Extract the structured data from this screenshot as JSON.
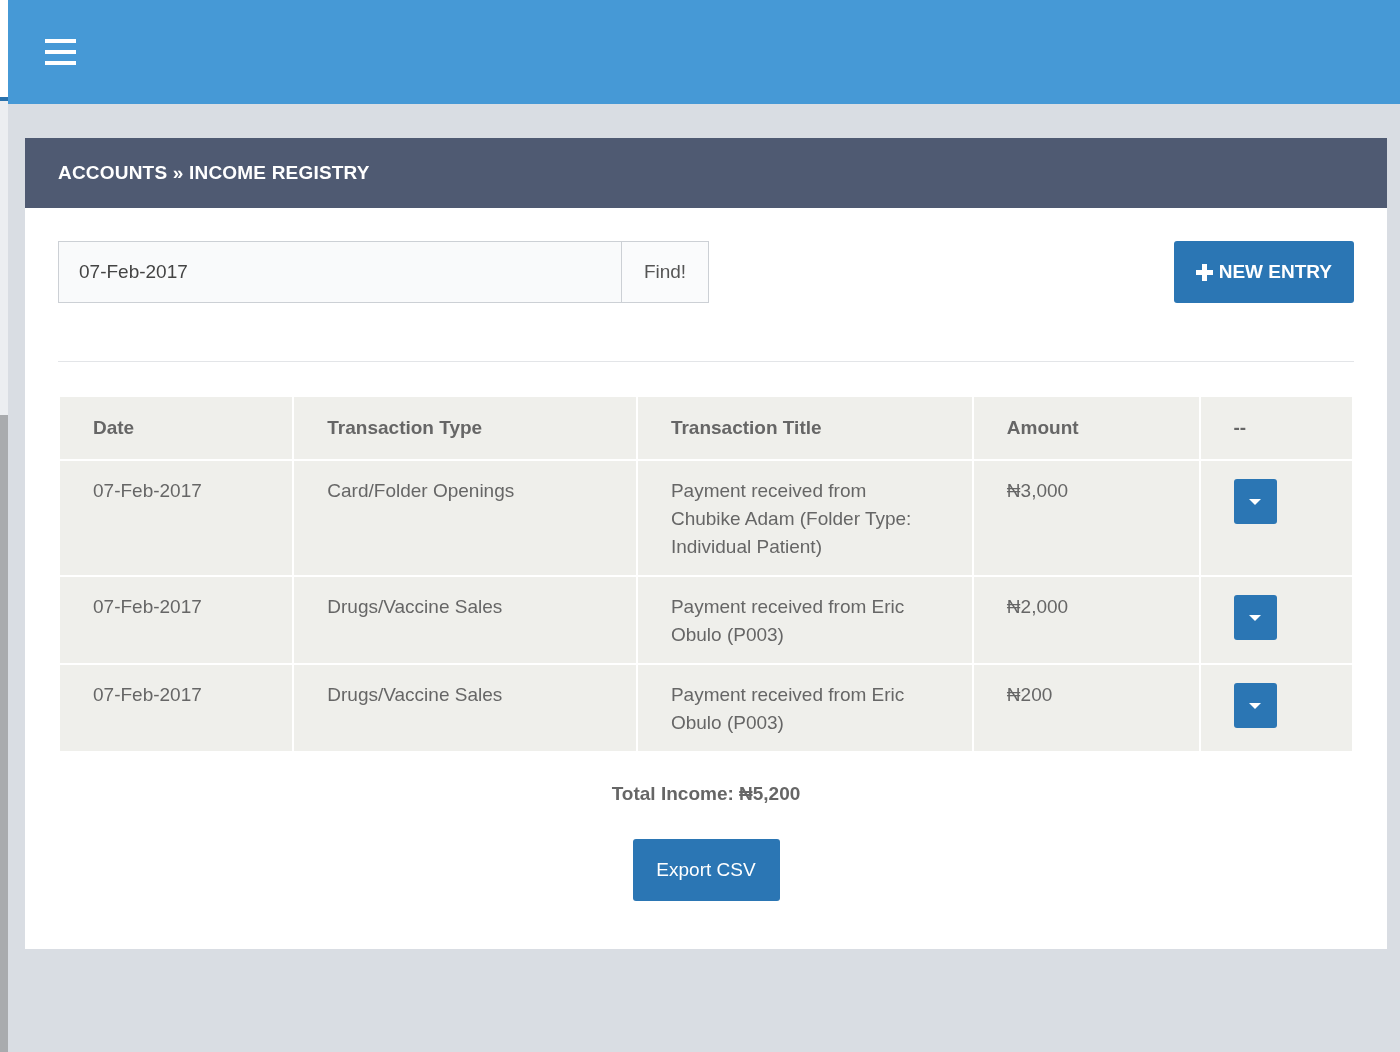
{
  "breadcrumb": {
    "section": "ACCOUNTS",
    "separator": "»",
    "page": "INCOME REGISTRY"
  },
  "search": {
    "value": "07-Feb-2017",
    "button": "Find!"
  },
  "new_entry_button": "NEW ENTRY",
  "table": {
    "columns": [
      "Date",
      "Transaction Type",
      "Transaction Title",
      "Amount",
      "--"
    ],
    "rows": [
      {
        "date": "07-Feb-2017",
        "type": "Card/Folder Openings",
        "title": "Payment received from Chubike Adam (Folder Type: Individual Patient)",
        "amount": "₦3,000"
      },
      {
        "date": "07-Feb-2017",
        "type": "Drugs/Vaccine Sales",
        "title": "Payment received from Eric Obulo (P003)",
        "amount": "₦2,000"
      },
      {
        "date": "07-Feb-2017",
        "type": "Drugs/Vaccine Sales",
        "title": "Payment received from Eric Obulo (P003)",
        "amount": "₦200"
      }
    ]
  },
  "total": "Total Income: ₦5,200",
  "export_button": "Export CSV"
}
